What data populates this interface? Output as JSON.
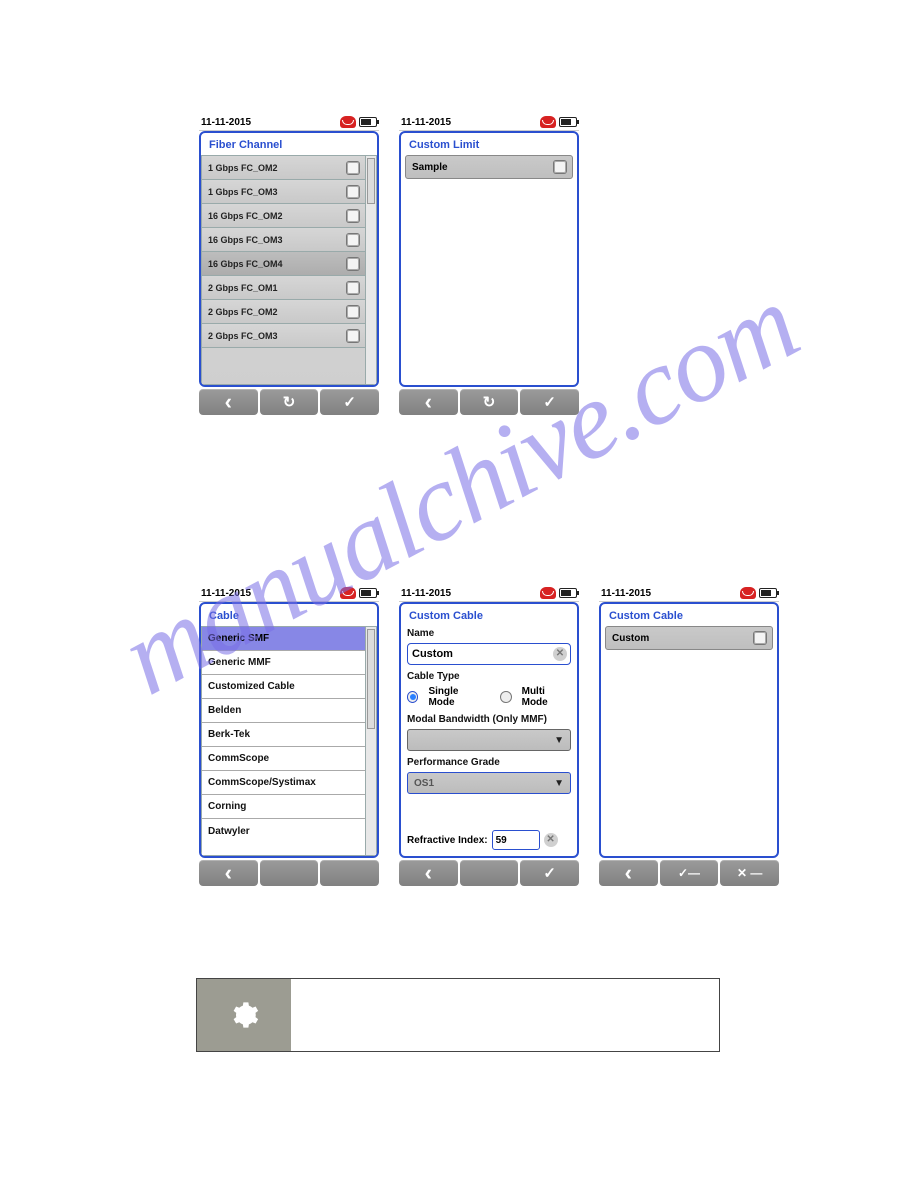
{
  "status": {
    "date": "11-11-2015"
  },
  "screen1": {
    "title": "Fiber Channel",
    "items": [
      "1 Gbps FC_OM2",
      "1 Gbps FC_OM3",
      "16 Gbps FC_OM2",
      "16 Gbps FC_OM3",
      "16 Gbps FC_OM4",
      "2 Gbps FC_OM1",
      "2 Gbps FC_OM2",
      "2 Gbps FC_OM3"
    ]
  },
  "screen2": {
    "title": "Custom Limit",
    "item": "Sample"
  },
  "screen3": {
    "title": "Cable",
    "items": [
      "Generic SMF",
      "Generic MMF",
      "Customized Cable",
      "Belden",
      "Berk-Tek",
      "CommScope",
      "CommScope/Systimax",
      "Corning",
      "Datwyler"
    ],
    "highlight_index": 0
  },
  "screen4": {
    "title": "Custom Cable",
    "name_label": "Name",
    "name_value": "Custom",
    "cable_type_label": "Cable Type",
    "radio_single": "Single Mode",
    "radio_multi": "Multi Mode",
    "modal_bw_label": "Modal Bandwidth (Only MMF)",
    "modal_bw_value": "",
    "perf_label": "Performance Grade",
    "perf_value": "OS1",
    "ri_label": "Refractive Index:",
    "ri_value": "59"
  },
  "screen5": {
    "title": "Custom Cable",
    "item": "Custom"
  },
  "icons": {
    "back": "‹",
    "refresh": "↻",
    "check": "✓",
    "edit": "✓—",
    "delete": "✕ —"
  }
}
